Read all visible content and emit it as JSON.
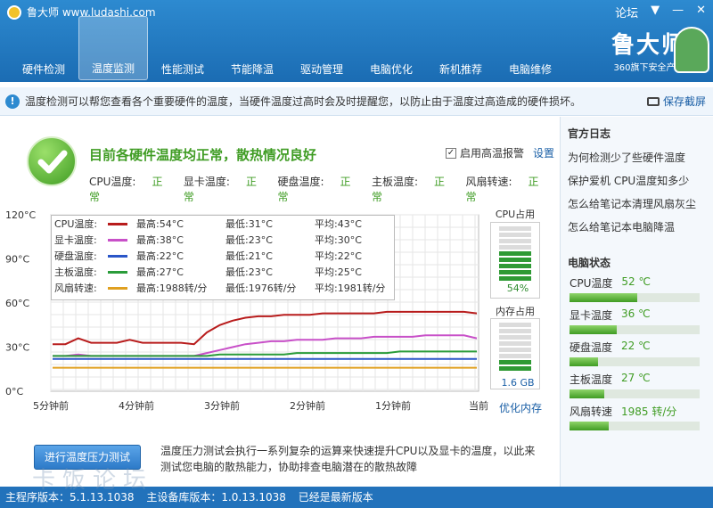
{
  "app": {
    "title": "鲁大师 www.ludashi.com",
    "forum": "论坛"
  },
  "toolbar": [
    {
      "label": "硬件检测",
      "icon": "monitor-magnifier-icon",
      "color": "#3a6fa8"
    },
    {
      "label": "温度监测",
      "icon": "thermometer-icon",
      "color": "#c8ced6"
    },
    {
      "label": "性能测试",
      "icon": "speedometer-icon",
      "color": "#b83030"
    },
    {
      "label": "节能降温",
      "icon": "clover-icon",
      "color": "#3a9c3a"
    },
    {
      "label": "驱动管理",
      "icon": "toolbox-icon",
      "color": "#c83a3a"
    },
    {
      "label": "电脑优化",
      "icon": "screen-broom-icon",
      "color": "#2e8f7a"
    },
    {
      "label": "新机推荐",
      "icon": "medal-icon",
      "color": "#e0b020"
    },
    {
      "label": "电脑维修",
      "icon": "house-icon",
      "color": "#d07a2a"
    }
  ],
  "brand": {
    "name": "鲁大师",
    "sub": "360旗下安全产品"
  },
  "info": {
    "text": "温度检测可以帮您查看各个重要硬件的温度，当硬件温度过高时会及时提醒您，以防止由于温度过高造成的硬件损坏。",
    "save_label": "保存截屏"
  },
  "status": {
    "title": "目前各硬件温度均正常，散热情况良好",
    "alarm_label": "启用高温报警",
    "settings_label": "设置",
    "items": [
      {
        "label": "CPU温度:",
        "value": "正常"
      },
      {
        "label": "显卡温度:",
        "value": "正常"
      },
      {
        "label": "硬盘温度:",
        "value": "正常"
      },
      {
        "label": "主板温度:",
        "value": "正常"
      },
      {
        "label": "风扇转速:",
        "value": "正常"
      }
    ]
  },
  "chart_data": {
    "type": "line",
    "y_ticks": [
      "120°C",
      "90°C",
      "60°C",
      "30°C",
      "0°C"
    ],
    "ylim": [
      0,
      120
    ],
    "x_ticks": [
      "5分钟前",
      "4分钟前",
      "3分钟前",
      "2分钟前",
      "1分钟前",
      "当前"
    ],
    "grid": true,
    "series": [
      {
        "name": "CPU温度:",
        "color": "#b81c1c",
        "max": "最高:54°C",
        "min": "最低:31°C",
        "avg": "平均:43°C",
        "values": [
          32,
          32,
          36,
          33,
          33,
          33,
          35,
          33,
          33,
          33,
          33,
          32,
          40,
          45,
          48,
          50,
          51,
          51,
          52,
          52,
          52,
          53,
          53,
          53,
          53,
          53,
          54,
          54,
          54,
          54,
          54,
          54,
          54,
          53
        ]
      },
      {
        "name": "显卡温度:",
        "color": "#c850c8",
        "max": "最高:38°C",
        "min": "最低:23°C",
        "avg": "平均:30°C",
        "values": [
          24,
          24,
          25,
          24,
          24,
          24,
          24,
          24,
          24,
          24,
          24,
          24,
          26,
          28,
          30,
          32,
          33,
          34,
          34,
          35,
          35,
          35,
          36,
          36,
          36,
          37,
          37,
          37,
          37,
          38,
          38,
          38,
          38,
          36
        ]
      },
      {
        "name": "硬盘温度:",
        "color": "#2a56c8",
        "max": "最高:22°C",
        "min": "最低:21°C",
        "avg": "平均:22°C",
        "values": [
          22,
          22,
          22,
          22,
          22,
          22,
          22,
          22,
          22,
          22,
          22,
          22,
          22,
          22,
          22,
          22,
          22,
          22,
          22,
          22,
          22,
          22,
          22,
          22,
          22,
          22,
          22,
          22,
          22,
          22,
          22,
          22,
          22,
          22
        ]
      },
      {
        "name": "主板温度:",
        "color": "#2a9c3a",
        "max": "最高:27°C",
        "min": "最低:23°C",
        "avg": "平均:25°C",
        "values": [
          24,
          24,
          24,
          24,
          24,
          24,
          24,
          24,
          24,
          24,
          24,
          24,
          24,
          25,
          25,
          25,
          25,
          25,
          25,
          26,
          26,
          26,
          26,
          26,
          26,
          26,
          26,
          27,
          27,
          27,
          27,
          27,
          27,
          27
        ]
      },
      {
        "name": "风扇转速:",
        "color": "#e0a020",
        "max": "最高:1988转/分",
        "min": "最低:1976转/分",
        "avg": "平均:1981转/分",
        "values": [
          16,
          16,
          16,
          16,
          16,
          16,
          16,
          16,
          16,
          16,
          16,
          16,
          16,
          16,
          16,
          16,
          16,
          16,
          16,
          16,
          16,
          16,
          16,
          16,
          16,
          16,
          16,
          16,
          16,
          16,
          16,
          16,
          16,
          16
        ]
      }
    ]
  },
  "meters": {
    "cpu": {
      "title": "CPU占用",
      "value": "54%",
      "fraction": 0.54
    },
    "mem": {
      "title": "内存占用",
      "value": "1.6 GB",
      "fraction": 0.25
    },
    "optimize_label": "优化内存"
  },
  "stress": {
    "button_label": "进行温度压力测试",
    "description": "温度压力测试会执行一系列复杂的运算来快速提升CPU以及显卡的温度，以此来测试您电脑的散热能力，协助排查电脑潜在的散热故障"
  },
  "sidebar": {
    "news_title": "官方日志",
    "news": [
      "为何检测少了些硬件温度",
      "保护爱机 CPU温度知多少",
      "怎么给笔记本清理风扇灰尘",
      "怎么给笔记本电脑降温"
    ],
    "status_title": "电脑状态",
    "items": [
      {
        "label": "CPU温度",
        "value": "52 ℃",
        "fraction": 0.52
      },
      {
        "label": "显卡温度",
        "value": "36 ℃",
        "fraction": 0.36
      },
      {
        "label": "硬盘温度",
        "value": "22 ℃",
        "fraction": 0.22
      },
      {
        "label": "主板温度",
        "value": "27 ℃",
        "fraction": 0.27
      },
      {
        "label": "风扇转速",
        "value": "1985 转/分",
        "fraction": 0.3
      }
    ]
  },
  "footer": {
    "main_version": "主程序版本：5.1.13.1038",
    "db_version": "主设备库版本：1.0.13.1038",
    "status": "已经是最新版本"
  },
  "watermark": "卡饭论坛"
}
